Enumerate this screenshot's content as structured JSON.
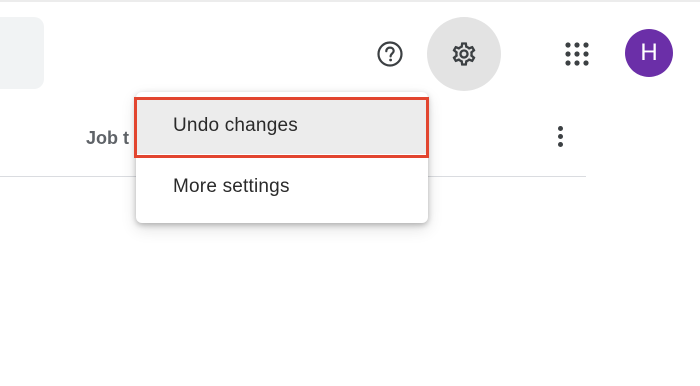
{
  "header": {
    "help_icon": "help-circle-icon",
    "settings_icon": "gear-icon",
    "apps_icon": "apps-grid-icon",
    "avatar_initial": "H",
    "avatar_color": "#6b2fa8"
  },
  "table": {
    "column_header": "Job t",
    "more_icon": "more-vert-icon"
  },
  "settings_menu": {
    "items": [
      {
        "label": "Undo changes",
        "highlighted": true
      },
      {
        "label": "More settings",
        "highlighted": false
      }
    ],
    "highlight_color": "#e2452f"
  }
}
